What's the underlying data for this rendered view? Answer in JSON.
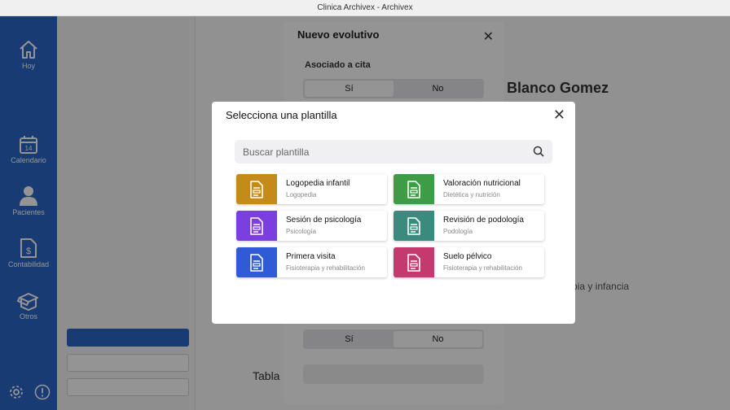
{
  "window": {
    "title": "Clinica Archivex - Archivex"
  },
  "sidebar": {
    "items": [
      {
        "label": "Hoy",
        "icon": "home-icon"
      },
      {
        "label": "Calendario",
        "icon": "calendar-icon",
        "badge": "14"
      },
      {
        "label": "Pacientes",
        "icon": "person-icon"
      },
      {
        "label": "Contabilidad",
        "icon": "document-dollar-icon"
      },
      {
        "label": "Otros",
        "icon": "box-icon"
      }
    ],
    "bottom": {
      "settings_icon": "gear-icon",
      "info_icon": "exclamation-icon"
    }
  },
  "background": {
    "patient_name_partial": "Blanco Gomez",
    "right_text_partial": "pia y infancia",
    "tabla_partial": "Tabla"
  },
  "evolutivo": {
    "title": "Nuevo evolutivo",
    "cita_label": "Asociado a cita",
    "yes": "Sí",
    "no": "No"
  },
  "modal": {
    "title": "Selecciona una plantilla",
    "search_placeholder": "Buscar plantilla",
    "templates": [
      {
        "name": "Logopedia infantil",
        "category": "Logopedia",
        "color": "#c48a1a"
      },
      {
        "name": "Valoración nutricional",
        "category": "Dietética y nutrición",
        "color": "#3e9b46"
      },
      {
        "name": "Sesión de psicología",
        "category": "Psicología",
        "color": "#7b3fe0"
      },
      {
        "name": "Revisión de podología",
        "category": "Podología",
        "color": "#3a8a7e"
      },
      {
        "name": "Primera visita",
        "category": "Fisioterapia y rehabilitación",
        "color": "#2f5bd6"
      },
      {
        "name": "Suelo pélvico",
        "category": "Fisioterapia y rehabilitación",
        "color": "#c43a6e"
      }
    ]
  },
  "colors": {
    "sidebar": "#2b67c7"
  }
}
